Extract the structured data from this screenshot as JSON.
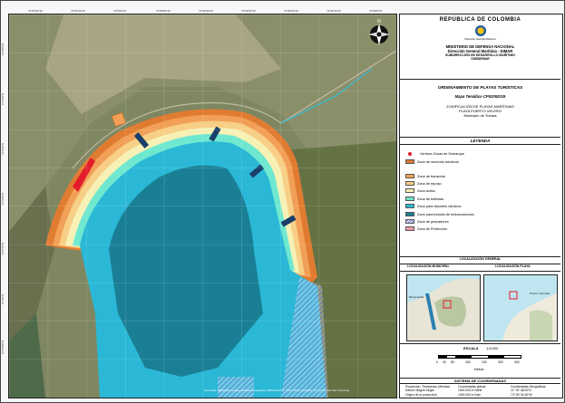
{
  "legend_colors": {
    "servicios": "#e07c32",
    "transicion": "#f2a057",
    "reposo": "#f7cf86",
    "activa": "#f7f1b5",
    "banistas": "#6fe8d0",
    "deportes": "#2ab8d6",
    "transito": "#1a7f95",
    "pescadores": "#6b7fd6",
    "proteccion": "#f29ca7",
    "vertice": "#e21c2c"
  },
  "header": {
    "country": "REPÚBLICA DE COLOMBIA",
    "ministry": "MINISTERIO DE DEFENSA NACIONAL",
    "direction": "Dirección General Marítima - DIMAR",
    "subdirection": "SUBDIRECCIÓN DE DESARROLLO MARÍTIMO",
    "subdirection_short": "SUBDEMAR",
    "logo_text": "Dirección General Marítima"
  },
  "title": {
    "main": "ORDENAMIENTO DE PLAYAS TURÍSTICAS",
    "map_name": "Mapa Temático CP02052019",
    "zoning": "ZONIFICACIÓN DE PLAYAS MARÍTIMAS",
    "beach": "PLAYA PUERTO VELERO",
    "municipality": "Municipio de Tubará"
  },
  "legend": {
    "heading": "LEYENDA",
    "items": [
      {
        "key": "vertice",
        "label": "Vertices Zonas de Embarque"
      },
      {
        "key": "servicios",
        "label": "Zona de servicios turísticos"
      },
      {
        "key": "transicion",
        "label": "Zona de transición"
      },
      {
        "key": "reposo",
        "label": "Zona de reposo"
      },
      {
        "key": "activa",
        "label": "Zona activa"
      },
      {
        "key": "banistas",
        "label": "Zona de bañistas"
      },
      {
        "key": "deportes",
        "label": "Zona para deportes náuticos"
      },
      {
        "key": "transito",
        "label": "Zona para tránsito de embarcaciones"
      },
      {
        "key": "pescadores",
        "label": "Zona de pescadores"
      },
      {
        "key": "proteccion",
        "label": "Zona de Protección"
      }
    ]
  },
  "location": {
    "heading": "LOCALIZACIÓN GENERAL",
    "municipal": "LOCALIZACIÓN MUNICIPAL",
    "beach": "LOCALIZACIÓN PLAYA",
    "inset_city": "Barranquilla",
    "inset_place": "Puerto Colombia"
  },
  "scale": {
    "heading": "ESCALA",
    "ratio": "1:8.000",
    "ticks": [
      "0",
      "40",
      "80",
      "160",
      "240",
      "320",
      "400"
    ],
    "unit": "Metros"
  },
  "coords": {
    "heading": "SISTEMA DE COORDENADAS",
    "rows": [
      [
        "Proyección: Transversa_Mercator",
        "Coordenadas planas",
        "Coordenadas Geográficas"
      ],
      [
        "Datum: Magna Sirgas",
        "1000.000 m Norte",
        "11° 00' 48.00\"N"
      ],
      [
        "Origen de la proyección",
        "1000.000 m Este",
        "74° 54' 54.00\"W"
      ]
    ]
  },
  "map": {
    "north_label": "N",
    "source_note": "Fuente Esri, DigitalGlobe, GeoEye, Earthstar Geographics, CNES/Airbus DS, USDA, USGS, AeroGRID, IGN, and the GIS User Community",
    "top_ticks": [
      "74°59'20\"W",
      "74°59'10\"W",
      "74°59'0\"W",
      "74°58'50\"W",
      "74°58'40\"W",
      "74°58'30\"W",
      "74°58'20\"W",
      "74°58'10\"W",
      "74°58'0\"W"
    ],
    "left_ticks": [
      "11°0'50\"N",
      "11°0'40\"N",
      "11°0'30\"N",
      "11°0'20\"N",
      "11°0'10\"N",
      "11°0'0\"N",
      "10°59'50\"N"
    ]
  }
}
